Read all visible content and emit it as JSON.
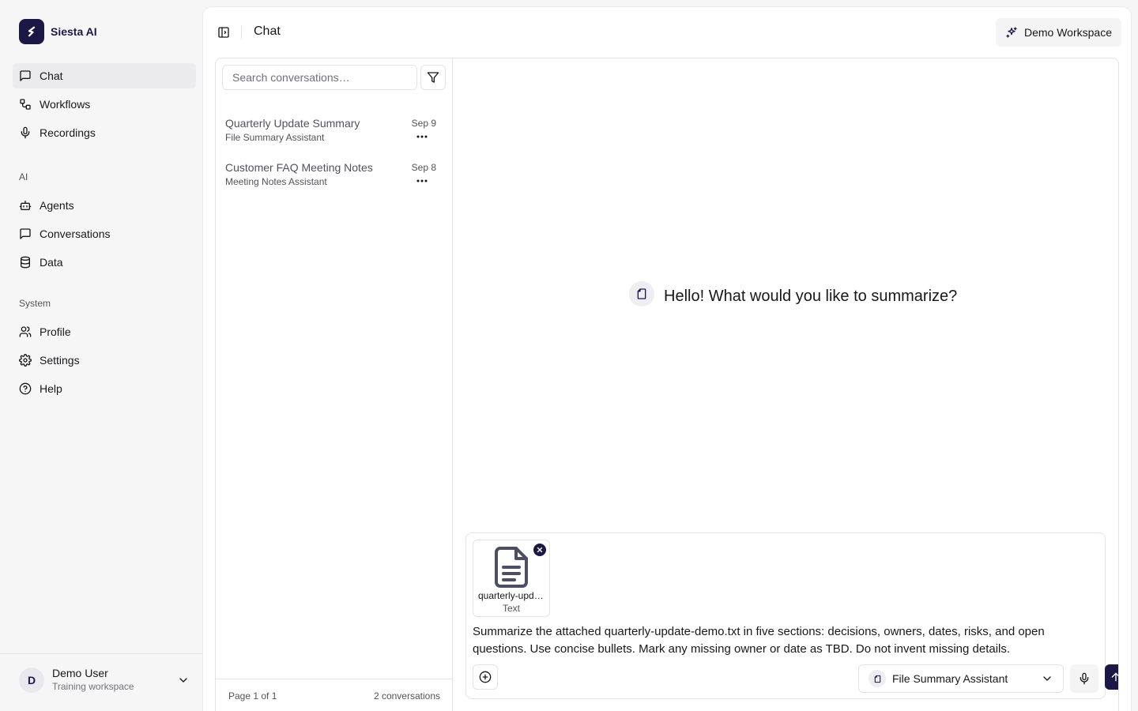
{
  "app": {
    "name": "Siesta AI"
  },
  "sidebar": {
    "items_main": [
      {
        "label": "Chat",
        "icon": "chat-bubble-icon",
        "active": true
      },
      {
        "label": "Workflows",
        "icon": "workflow-icon"
      },
      {
        "label": "Recordings",
        "icon": "microphone-icon"
      }
    ],
    "section_ai": "AI",
    "items_ai": [
      {
        "label": "Agents",
        "icon": "bot-icon"
      },
      {
        "label": "Conversations",
        "icon": "chat-bubble-icon"
      },
      {
        "label": "Data",
        "icon": "database-icon"
      }
    ],
    "section_system": "System",
    "items_system": [
      {
        "label": "Profile",
        "icon": "users-icon"
      },
      {
        "label": "Settings",
        "icon": "gear-icon"
      },
      {
        "label": "Help",
        "icon": "help-icon"
      }
    ],
    "user": {
      "initial": "D",
      "name": "Demo User",
      "subtitle": "Training workspace"
    }
  },
  "header": {
    "title": "Chat",
    "workspace_label": "Demo Workspace"
  },
  "conversations": {
    "search_placeholder": "Search conversations…",
    "items": [
      {
        "title": "Quarterly Update Summary",
        "subtitle": "File Summary Assistant",
        "date": "Sep 9"
      },
      {
        "title": "Customer FAQ Meeting Notes",
        "subtitle": "Meeting Notes Assistant",
        "date": "Sep 8"
      }
    ],
    "page_info": "Page 1 of 1",
    "count_label": "2 conversations"
  },
  "chat": {
    "greeting": "Hello! What would you like to summarize?",
    "attachment": {
      "name": "quarterly-update-demo.txt",
      "type": "Text"
    },
    "message": "Summarize the attached quarterly-update-demo.txt in five sections: decisions, owners, dates, risks, and open questions. Use concise bullets. Mark any missing owner or date as TBD. Do not invent missing details.",
    "agent_name": "File Summary Assistant"
  },
  "colors": {
    "brand": "#1c1846",
    "active_nav": "#ebebed",
    "border": "#e4e4e7"
  }
}
